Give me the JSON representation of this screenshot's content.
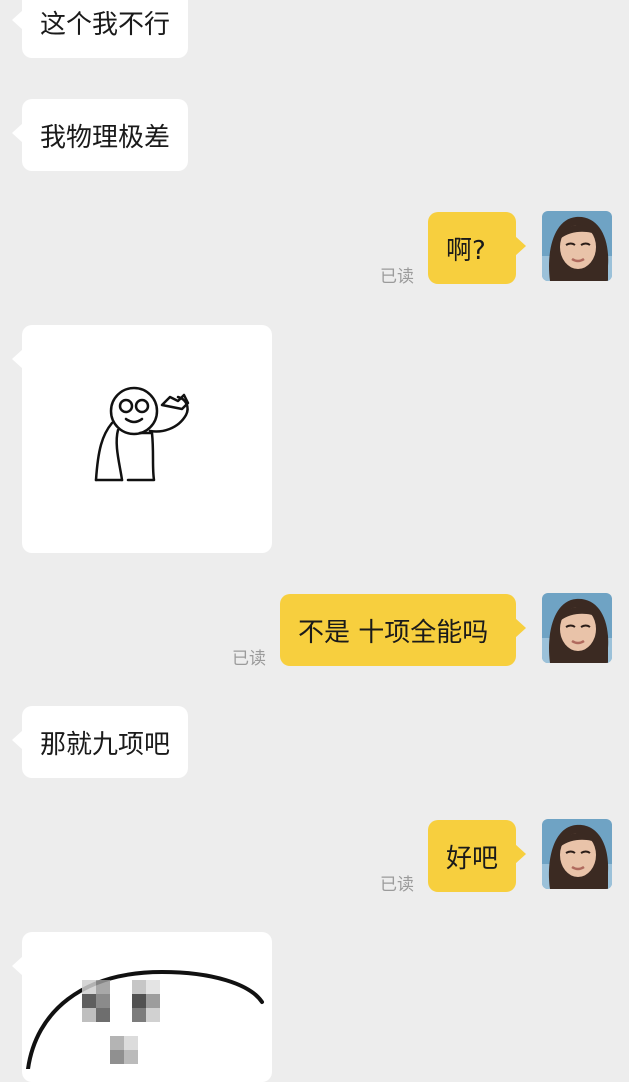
{
  "messages": [
    {
      "side": "left",
      "text": "这个我不行"
    },
    {
      "side": "left",
      "text": "我物理极差"
    },
    {
      "side": "right",
      "text": "啊?",
      "status": "已读"
    },
    {
      "side": "left",
      "type": "sticker",
      "sticker": "stick-figure-scratching-head"
    },
    {
      "side": "right",
      "text": "不是 十项全能吗",
      "status": "已读"
    },
    {
      "side": "left",
      "text": "那就九项吧"
    },
    {
      "side": "right",
      "text": "好吧",
      "status": "已读"
    },
    {
      "side": "left",
      "type": "sticker",
      "sticker": "pixelated-round-face"
    }
  ],
  "colors": {
    "background": "#ededed",
    "left_bubble": "#ffffff",
    "right_bubble": "#f7cf3e",
    "read_status": "#9b9b9b"
  }
}
